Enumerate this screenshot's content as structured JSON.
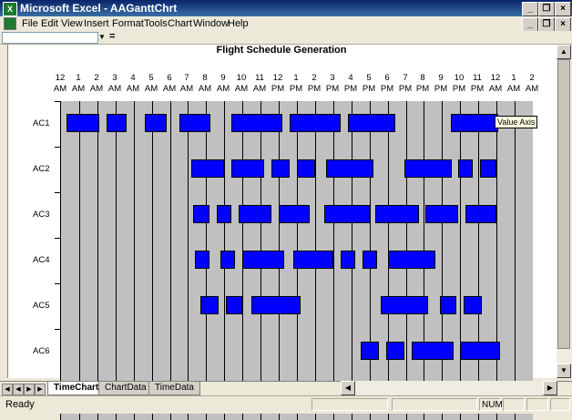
{
  "window": {
    "title": "Microsoft Excel - AAGanttChrt"
  },
  "menubar": {
    "items": [
      "File",
      "Edit",
      "View",
      "Insert",
      "Format",
      "Tools",
      "Chart",
      "Window",
      "Help"
    ]
  },
  "formula_bar": {
    "name_box": "",
    "equals": "="
  },
  "chart": {
    "title": "Flight Schedule Generation",
    "tooltip": "Value Axis",
    "time_labels": [
      [
        "12",
        "AM"
      ],
      [
        "1",
        "AM"
      ],
      [
        "2",
        "AM"
      ],
      [
        "3",
        "AM"
      ],
      [
        "4",
        "AM"
      ],
      [
        "5",
        "AM"
      ],
      [
        "6",
        "AM"
      ],
      [
        "7",
        "AM"
      ],
      [
        "8",
        "AM"
      ],
      [
        "9",
        "AM"
      ],
      [
        "10",
        "AM"
      ],
      [
        "11",
        "AM"
      ],
      [
        "12",
        "PM"
      ],
      [
        "1",
        "PM"
      ],
      [
        "2",
        "PM"
      ],
      [
        "3",
        "PM"
      ],
      [
        "4",
        "PM"
      ],
      [
        "5",
        "PM"
      ],
      [
        "6",
        "PM"
      ],
      [
        "7",
        "PM"
      ],
      [
        "8",
        "PM"
      ],
      [
        "9",
        "PM"
      ],
      [
        "10",
        "PM"
      ],
      [
        "11",
        "PM"
      ],
      [
        "12",
        "AM"
      ],
      [
        "1",
        "AM"
      ],
      [
        "2",
        "AM"
      ]
    ],
    "rows": [
      {
        "label": "AC1",
        "bars": [
          [
            0.3,
            2.1
          ],
          [
            2.5,
            3.6
          ],
          [
            4.6,
            5.8
          ],
          [
            6.5,
            8.2
          ],
          [
            9.4,
            12.2
          ],
          [
            12.6,
            15.4
          ],
          [
            15.8,
            18.4
          ],
          [
            21.5,
            24.1
          ]
        ]
      },
      {
        "label": "AC2",
        "bars": [
          [
            7.2,
            9.0
          ],
          [
            9.4,
            11.2
          ],
          [
            11.6,
            12.6
          ],
          [
            13.0,
            14.0
          ],
          [
            14.6,
            17.2
          ],
          [
            18.9,
            21.5
          ],
          [
            21.9,
            22.7
          ],
          [
            23.1,
            24.0
          ]
        ]
      },
      {
        "label": "AC3",
        "bars": [
          [
            7.3,
            8.2
          ],
          [
            8.6,
            9.4
          ],
          [
            9.8,
            11.6
          ],
          [
            12.0,
            13.7
          ],
          [
            14.5,
            17.0
          ],
          [
            17.3,
            19.7
          ],
          [
            20.1,
            21.9
          ],
          [
            22.3,
            24.0
          ]
        ]
      },
      {
        "label": "AC4",
        "bars": [
          [
            7.4,
            8.2
          ],
          [
            8.8,
            9.6
          ],
          [
            10.0,
            12.3
          ],
          [
            12.8,
            15.0
          ],
          [
            15.4,
            16.2
          ],
          [
            16.6,
            17.4
          ],
          [
            18.0,
            20.6
          ]
        ]
      },
      {
        "label": "AC5",
        "bars": [
          [
            7.7,
            8.7
          ],
          [
            9.1,
            10.0
          ],
          [
            10.5,
            13.2
          ],
          [
            17.6,
            20.2
          ],
          [
            20.9,
            21.8
          ],
          [
            22.2,
            23.2
          ]
        ]
      },
      {
        "label": "AC6",
        "bars": [
          [
            16.5,
            17.5
          ],
          [
            17.9,
            18.9
          ],
          [
            19.3,
            21.6
          ],
          [
            22.0,
            24.2
          ]
        ]
      }
    ]
  },
  "sheet_tabs": [
    "TimeChart",
    "ChartData",
    "TimeData"
  ],
  "active_tab": "TimeChart",
  "status": {
    "text": "Ready",
    "num": "NUM"
  }
}
